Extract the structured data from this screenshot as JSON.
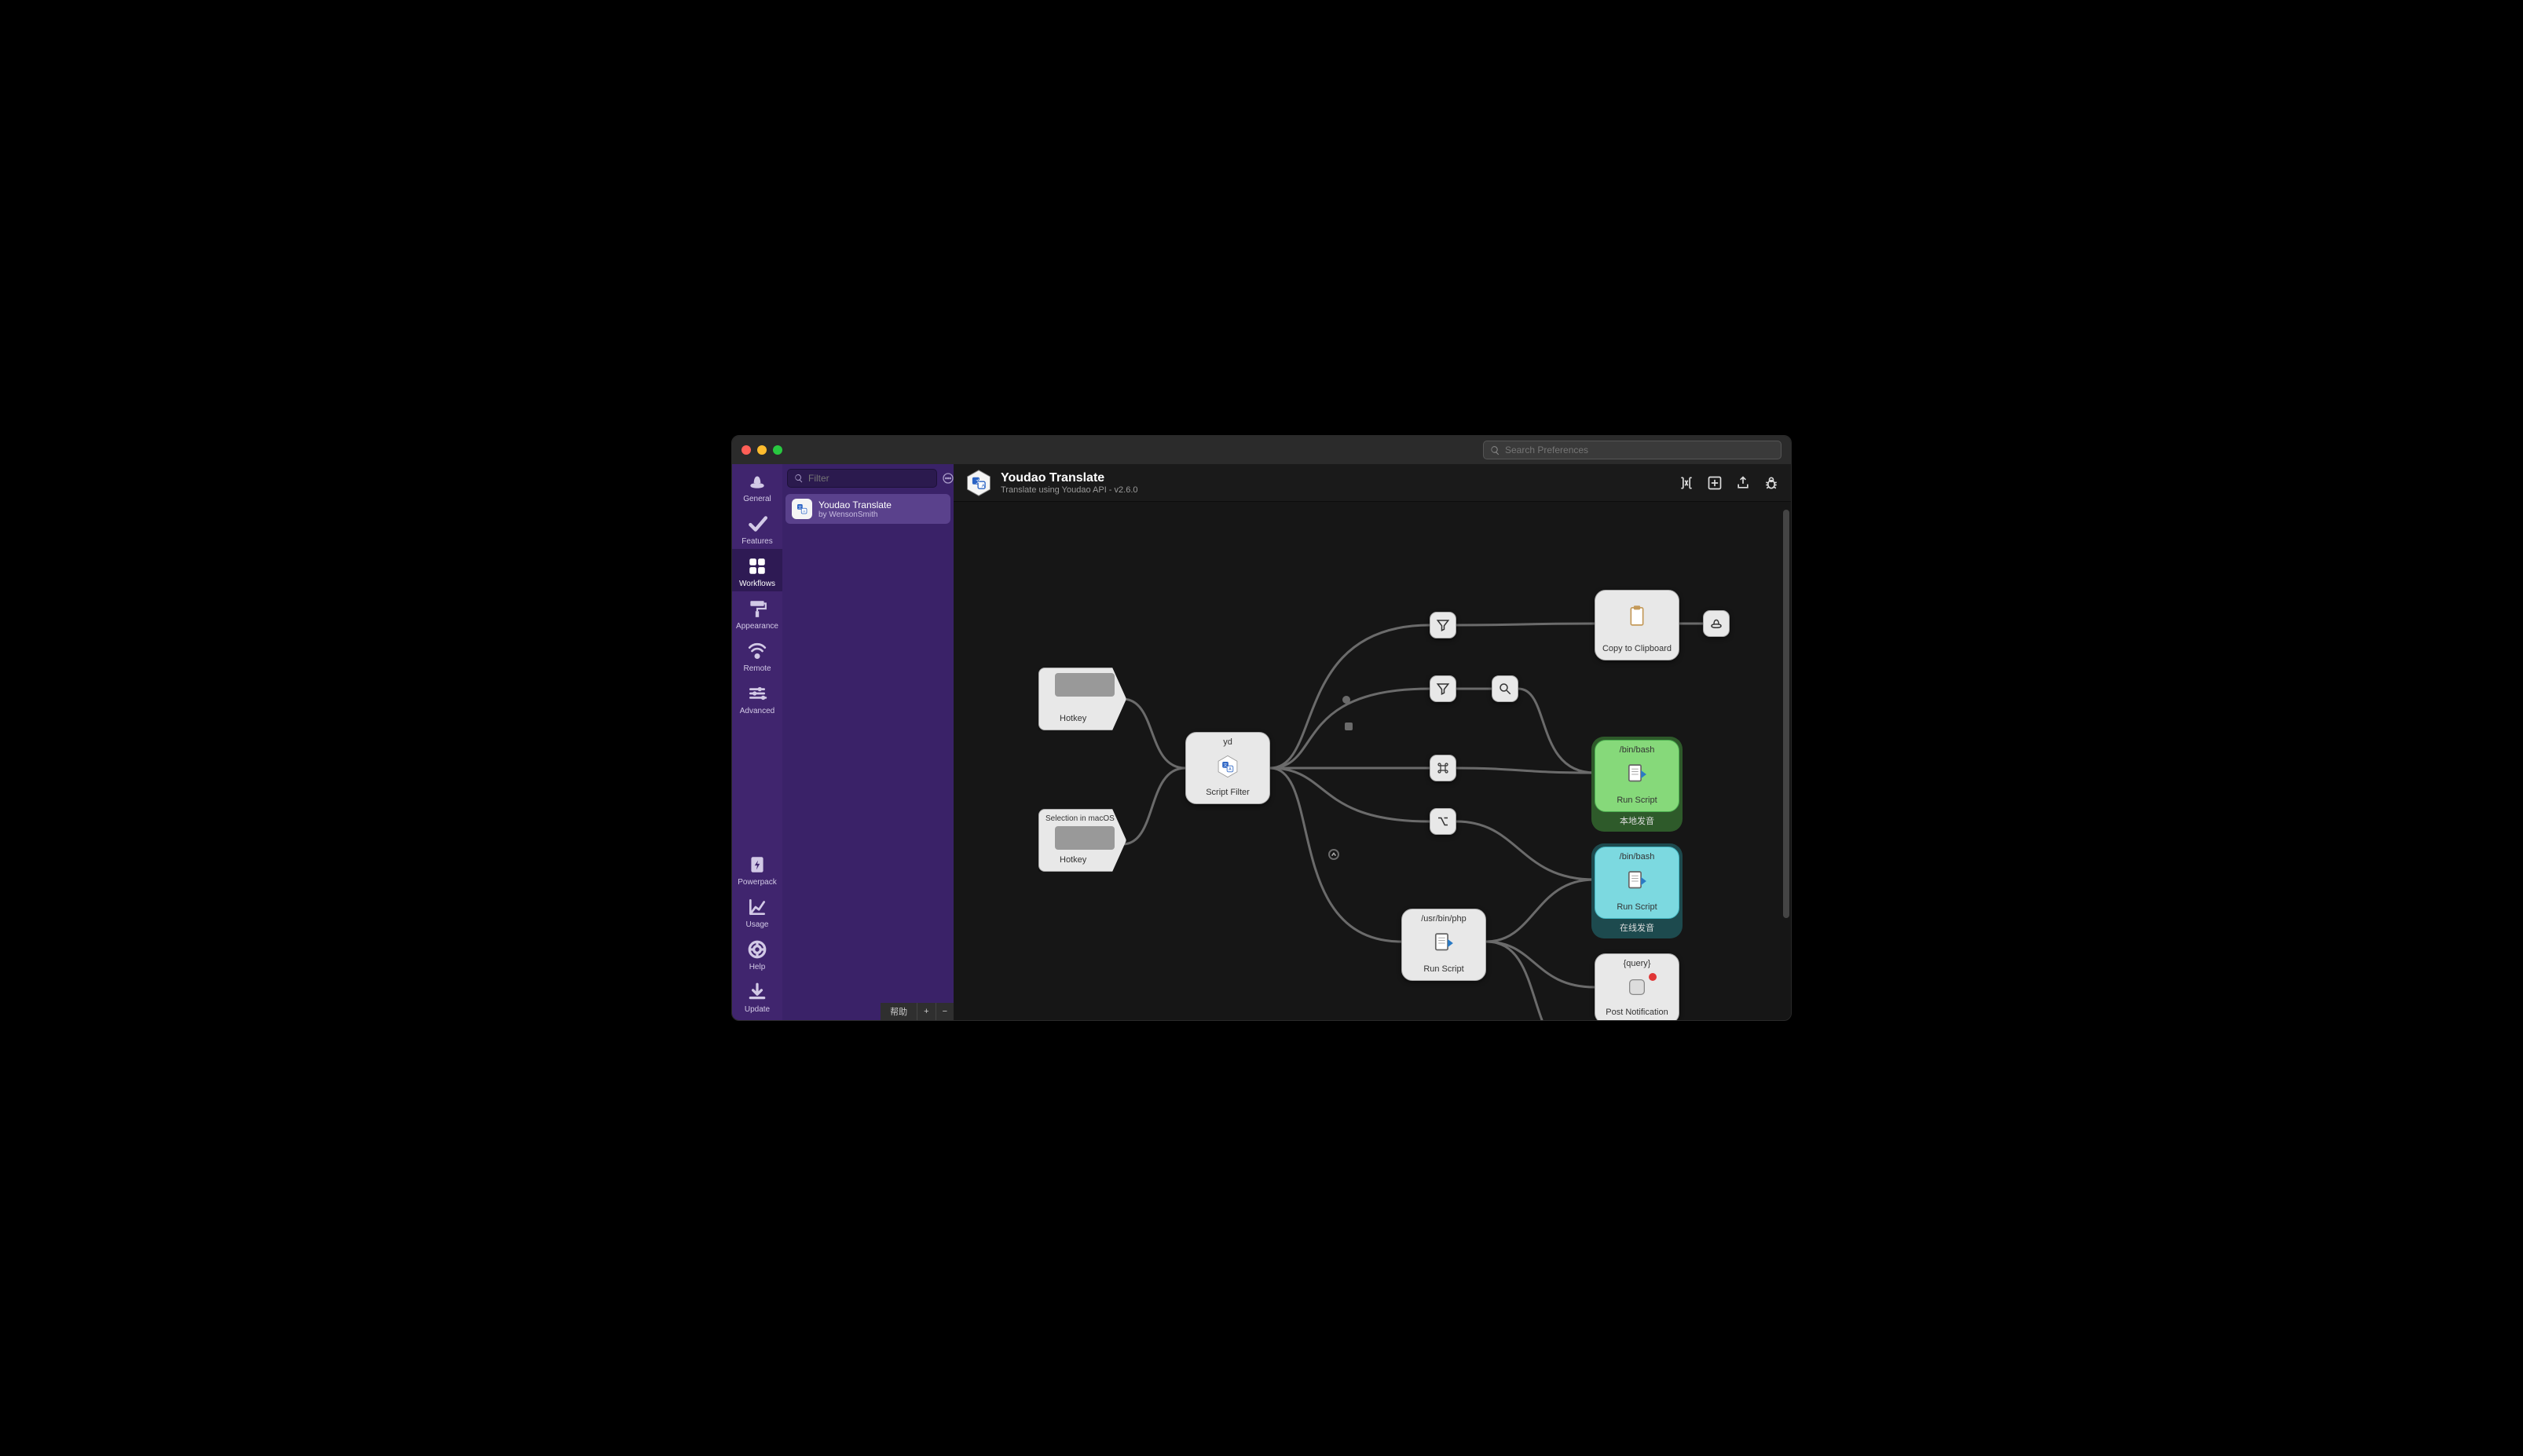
{
  "titlebar": {
    "traffic": {
      "close": "#ff5f57",
      "min": "#febc2e",
      "max": "#28c840"
    },
    "search_placeholder": "Search Preferences"
  },
  "sidebar": {
    "top": [
      {
        "key": "general",
        "label": "General",
        "icon": "hat"
      },
      {
        "key": "features",
        "label": "Features",
        "icon": "check"
      },
      {
        "key": "workflows",
        "label": "Workflows",
        "icon": "grid",
        "active": true
      },
      {
        "key": "appearance",
        "label": "Appearance",
        "icon": "roller"
      },
      {
        "key": "remote",
        "label": "Remote",
        "icon": "signal"
      },
      {
        "key": "advanced",
        "label": "Advanced",
        "icon": "sliders"
      }
    ],
    "bottom": [
      {
        "key": "powerpack",
        "label": "Powerpack",
        "icon": "battery"
      },
      {
        "key": "usage",
        "label": "Usage",
        "icon": "chart"
      },
      {
        "key": "help",
        "label": "Help",
        "icon": "life"
      },
      {
        "key": "update",
        "label": "Update",
        "icon": "download"
      }
    ]
  },
  "list": {
    "filter_placeholder": "Filter",
    "items": [
      {
        "title": "Youdao Translate",
        "subtitle": "by WensonSmith",
        "selected": true
      }
    ],
    "footer": {
      "help": "帮助",
      "plus": "+",
      "minus": "−"
    }
  },
  "header": {
    "title": "Youdao Translate",
    "subtitle": "Translate using Youdao API - v2.6.0",
    "actions": [
      "vars",
      "prefs",
      "export",
      "debug"
    ]
  },
  "nodes": {
    "hotkey1": {
      "label": "Hotkey"
    },
    "hotkey2": {
      "top": "Selection in macOS",
      "label": "Hotkey"
    },
    "scriptFilter": {
      "top": "yd",
      "label": "Script Filter"
    },
    "filter1": {
      "icon": "funnel"
    },
    "filter2": {
      "icon": "funnel"
    },
    "search": {
      "icon": "search"
    },
    "cmd": {
      "icon": "cmd"
    },
    "opt": {
      "icon": "opt"
    },
    "clipboard": {
      "label": "Copy to Clipboard"
    },
    "hat": {
      "icon": "hat"
    },
    "runGreen": {
      "top": "/bin/bash",
      "label": "Run Script",
      "under": "本地发音"
    },
    "runCyan": {
      "top": "/bin/bash",
      "label": "Run Script",
      "under": "在线发音"
    },
    "runPhp": {
      "top": "/usr/bin/php",
      "label": "Run Script"
    },
    "postNotif": {
      "top": "{query}",
      "label": "Post Notification"
    }
  }
}
